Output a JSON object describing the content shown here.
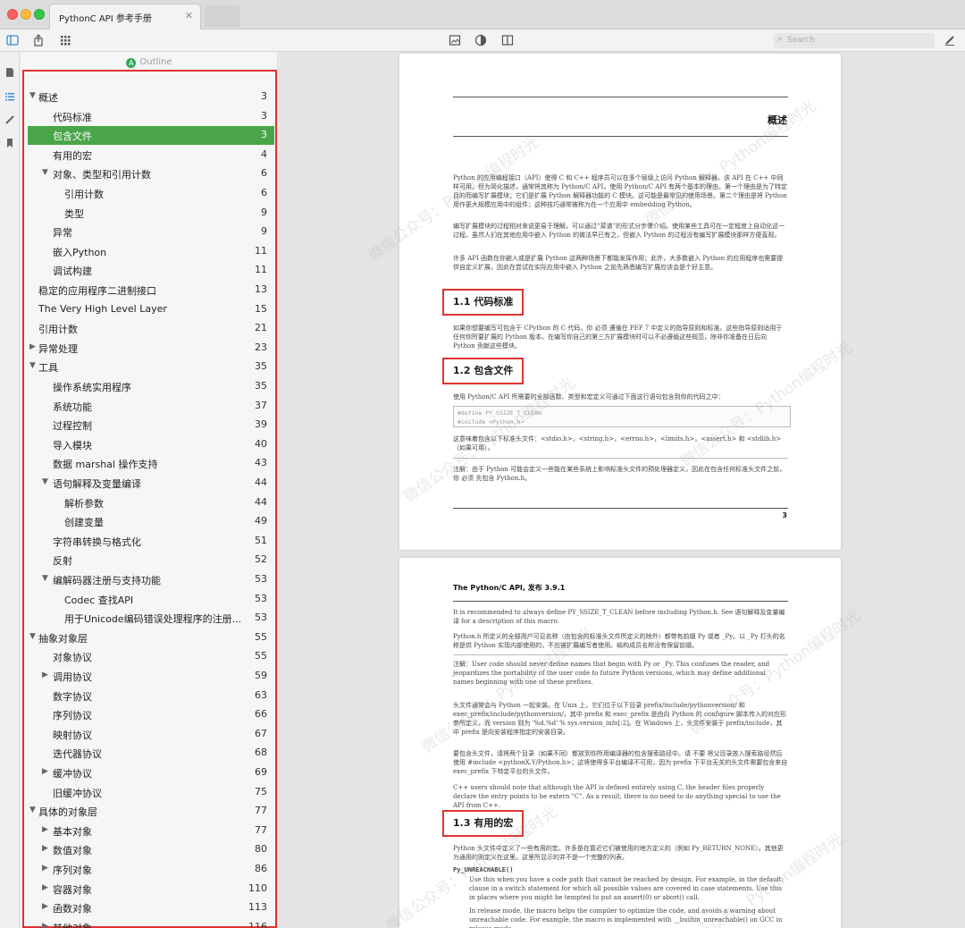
{
  "window": {
    "tab_title": "PythonC API 参考手册",
    "tab_close": "✕"
  },
  "toolbar": {
    "search_placeholder": "Search",
    "search_glyph": "⌕"
  },
  "outline": {
    "title": "Outline",
    "badge": "A",
    "items": [
      {
        "label": "概述",
        "page": "3",
        "level": 0,
        "tri": "▼"
      },
      {
        "label": "代码标准",
        "page": "3",
        "level": 1,
        "tri": ""
      },
      {
        "label": "包含文件",
        "page": "3",
        "level": 1,
        "tri": "",
        "active": true
      },
      {
        "label": "有用的宏",
        "page": "4",
        "level": 1,
        "tri": ""
      },
      {
        "label": "对象、类型和引用计数",
        "page": "6",
        "level": 1,
        "tri": "▼"
      },
      {
        "label": "引用计数",
        "page": "6",
        "level": 2,
        "tri": ""
      },
      {
        "label": "类型",
        "page": "9",
        "level": 2,
        "tri": ""
      },
      {
        "label": "异常",
        "page": "9",
        "level": 1,
        "tri": ""
      },
      {
        "label": "嵌入Python",
        "page": "11",
        "level": 1,
        "tri": ""
      },
      {
        "label": "调试构建",
        "page": "11",
        "level": 1,
        "tri": ""
      },
      {
        "label": "稳定的应用程序二进制接口",
        "page": "13",
        "level": 0,
        "tri": ""
      },
      {
        "label": "The Very High Level Layer",
        "page": "15",
        "level": 0,
        "tri": ""
      },
      {
        "label": "引用计数",
        "page": "21",
        "level": 0,
        "tri": ""
      },
      {
        "label": "异常处理",
        "page": "23",
        "level": 0,
        "tri": "▶"
      },
      {
        "label": "工具",
        "page": "35",
        "level": 0,
        "tri": "▼"
      },
      {
        "label": "操作系统实用程序",
        "page": "35",
        "level": 1,
        "tri": ""
      },
      {
        "label": "系统功能",
        "page": "37",
        "level": 1,
        "tri": ""
      },
      {
        "label": "过程控制",
        "page": "39",
        "level": 1,
        "tri": ""
      },
      {
        "label": "导入模块",
        "page": "40",
        "level": 1,
        "tri": ""
      },
      {
        "label": "数据 marshal 操作支持",
        "page": "43",
        "level": 1,
        "tri": ""
      },
      {
        "label": "语句解释及变量编译",
        "page": "44",
        "level": 1,
        "tri": "▼"
      },
      {
        "label": "解析参数",
        "page": "44",
        "level": 2,
        "tri": ""
      },
      {
        "label": "创建变量",
        "page": "49",
        "level": 2,
        "tri": ""
      },
      {
        "label": "字符串转换与格式化",
        "page": "51",
        "level": 1,
        "tri": ""
      },
      {
        "label": "反射",
        "page": "52",
        "level": 1,
        "tri": ""
      },
      {
        "label": "编解码器注册与支持功能",
        "page": "53",
        "level": 1,
        "tri": "▼"
      },
      {
        "label": "Codec 查找API",
        "page": "53",
        "level": 2,
        "tri": ""
      },
      {
        "label": "用于Unicode编码错误处理程序的注册...",
        "page": "53",
        "level": 2,
        "tri": ""
      },
      {
        "label": "抽象对象层",
        "page": "55",
        "level": 0,
        "tri": "▼"
      },
      {
        "label": "对象协议",
        "page": "55",
        "level": 1,
        "tri": ""
      },
      {
        "label": "调用协议",
        "page": "59",
        "level": 1,
        "tri": "▶"
      },
      {
        "label": "数字协议",
        "page": "63",
        "level": 1,
        "tri": ""
      },
      {
        "label": "序列协议",
        "page": "66",
        "level": 1,
        "tri": ""
      },
      {
        "label": "映射协议",
        "page": "67",
        "level": 1,
        "tri": ""
      },
      {
        "label": "迭代器协议",
        "page": "68",
        "level": 1,
        "tri": ""
      },
      {
        "label": "缓冲协议",
        "page": "69",
        "level": 1,
        "tri": "▶"
      },
      {
        "label": "旧缓冲协议",
        "page": "75",
        "level": 1,
        "tri": ""
      },
      {
        "label": "具体的对象层",
        "page": "77",
        "level": 0,
        "tri": "▼"
      },
      {
        "label": "基本对象",
        "page": "77",
        "level": 1,
        "tri": "▶"
      },
      {
        "label": "数值对象",
        "page": "80",
        "level": 1,
        "tri": "▶"
      },
      {
        "label": "序列对象",
        "page": "86",
        "level": 1,
        "tri": "▶"
      },
      {
        "label": "容器对象",
        "page": "110",
        "level": 1,
        "tri": "▶"
      },
      {
        "label": "函数对象",
        "page": "113",
        "level": 1,
        "tri": "▶"
      },
      {
        "label": "其他对象",
        "page": "116",
        "level": 1,
        "tri": "▶"
      }
    ]
  },
  "page1": {
    "chapter_title": "概述",
    "para1": "Python 的应用编程接口（API）使得 C 和 C++ 程序员可以在多个层级上访问 Python 解释器。该 API 在 C++ 中同样可用，但为简化描述，通常将其称为 Python/C API。使用 Python/C API 有两个基本的理由。第一个理由是为了特定目的而编写扩展模块；它们是扩展 Python 解释器功能的 C 模块。这可能是最常见的使用场景。第二个理由是将 Python 用作更大规模应用中的组件；这种技巧通常被称为在一个应用中 embedding Python。",
    "para2": "编写扩展模块的过程相对来说更易于理解，可以通过“菜谱”的形式分步骤介绍。使用某些工具可在一定程度上自动化这一过程。虽然人们在其他应用中嵌入 Python 的做法早已有之，但嵌入 Python 的过程没有编写扩展模块那样方便直观。",
    "para3": "许多 API 函数在你嵌入或是扩展 Python 这两种场景下都能发挥作用；此外，大多数嵌入 Python 的应用程序也需要提供自定义扩展，因此在尝试在实际应用中嵌入 Python 之前先熟悉编写扩展应该会是个好主意。",
    "sec11": "1.1  代码标准",
    "para4": "如果你想要编写可包含于 CPython 的 C 代码，你 必须 遵循在 PEP 7 中定义的指导原则和标准。这些指导原则适用于任何你所要扩展的 Python 版本。在编写你自己的第三方扩展模块时可以不必遵循这些规范，除非你准备在日后向 Python 贡献这些模块。",
    "sec12": "1.2  包含文件",
    "para5": "使用 Python/C API 所需要的全部函数、类型和宏定义可通过下面这行语句包含到你的代码之中：",
    "code1": "#define PY_SSIZE_T_CLEAN",
    "code2": "#include <Python.h>",
    "para6": "这意味着包含以下标准头文件：<stdio.h>，<string.h>，<errno.h>，<limits.h>，<assert.h> 和 <stdlib.h>（如果可用）。",
    "note": "注解：由于 Python 可能会定义一些能在某些系统上影响标准头文件的预处理器定义，因此在包含任何标准头文件之前，你 必须 先包含 Python.h。",
    "page_number": "3"
  },
  "page2": {
    "running_head": "The Python/C API, 发布 3.9.1",
    "para1": "It is recommended to always define PY_SSIZE_T_CLEAN before including Python.h. See 语句解释及变量编译 for a description of this macro.",
    "para2": "Python.h 所定义的全部用户可见名称（由包含的标准头文件所定义的除外）都带有前缀 Py 或者 _Py。以 _Py 打头的名称是供 Python 实现内部使用的，不应被扩展编写者使用。结构成员名称没有保留前缀。",
    "note": "注解：User code should never define names that begin with Py or _Py. This confuses the reader, and jeopardizes the portability of the user code to future Python versions, which may define additional names beginning with one of these prefixes.",
    "para3": "头文件通常会与 Python 一起安装。在 Unix 上，它们位于以下目录 prefix/include/pythonversion/ 和 exec_prefix/include/pythonversion/，其中 prefix 和 exec_prefix 是由向 Python 的 configure 脚本传入的对应形参所定义，而 version 则为 '%d.%d' % sys.version_info[:2]。在 Windows 上，头文件安装于 prefix/include，其中 prefix 是向安装程序指定的安装目录。",
    "para4": "要包含头文件，请将两个目录（如果不同）都放到你所用编译器的包含搜索路径中。请 不要 将父目录放入搜索路径然后使用 #include <pythonX.Y/Python.h>；这将使得多平台编译不可用，因为 prefix 下平台无关的头文件需要包含来自 exec_prefix 下特定平台的头文件。",
    "para5": "C++ users should note that although the API is defined entirely using C, the header files properly declare the entry points to be extern \"C\". As a result, there is no need to do anything special to use the API from C++.",
    "sec13": "1.3  有用的宏",
    "para6": "Python 头文件中定义了一些有用的宏。许多是在靠近它们被使用的地方定义的（例如 Py_RETURN_NONE）。其他更为通用的则定义在这里。这里所显示的并不是一个完整的列表。",
    "macro": "Py_UNREACHABLE()",
    "para7": "Use this when you have a code path that cannot be reached by design. For example, in the default: clause in a switch statement for which all possible values are covered in case statements. Use this in places where you might be tempted to put an assert(0) or abort() call.",
    "para8": "In release mode, the macro helps the compiler to optimize the code, and avoids a warning about unreachable code. For example, the macro is implemented with __builtin_unreachable() on GCC in release mode."
  },
  "watermark": "微信公众号：Python编程时光",
  "colors": {
    "highlight": "#e03333",
    "active_row": "#4aa54a",
    "accent": "#3a87d6"
  }
}
